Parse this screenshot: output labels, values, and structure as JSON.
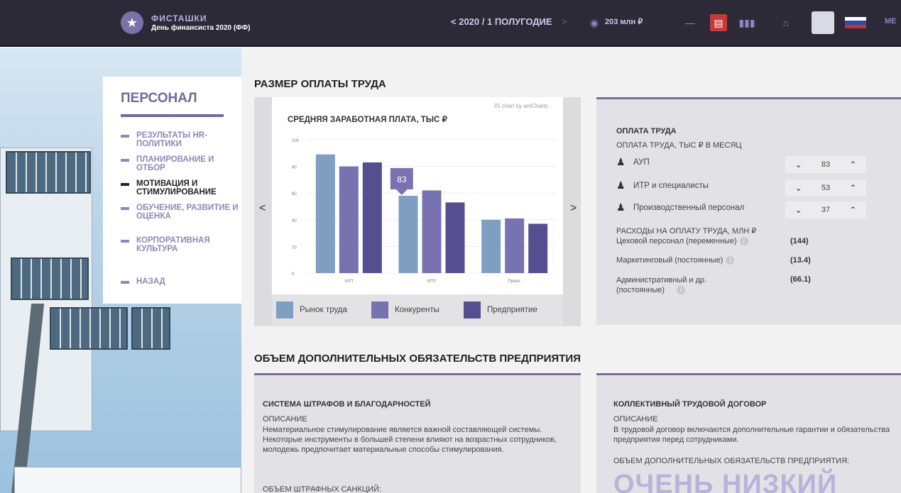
{
  "topbar": {
    "brand_name": "ФИСТАШКИ",
    "brand_sub": "День финансиста 2020 (ФФ)",
    "period_prev": "<",
    "period_label": "2020 / 1 ПОЛУГОДИЕ",
    "period_next": ">",
    "budget": "203 млн ₽",
    "menu_short": "МЕ",
    "icons": [
      "star-icon",
      "coins-icon",
      "minus-icon",
      "book-icon",
      "chart-icon",
      "briefcase-icon",
      "avatar",
      "flag-icon"
    ],
    "book_color": "#c73a3a"
  },
  "menu": {
    "title": "ПЕРСОНАЛ",
    "items": [
      {
        "label": "РЕЗУЛЬТАТЫ HR-ПОЛИТИКИ"
      },
      {
        "label": "ПЛАНИРОВАНИЕ И ОТБОР"
      },
      {
        "label": "МОТИВАЦИЯ И СТИМУЛИРОВАНИЕ",
        "active": true
      },
      {
        "label": "ОБУЧЕНИЕ, РАЗВИТИЕ И ОЦЕНКА"
      },
      {
        "label": "КОРПОРАТИВНАЯ КУЛЬТУРА"
      }
    ],
    "back": "НАЗАД"
  },
  "section1": {
    "title": "РАЗМЕР ОПЛАТЫ ТРУДА"
  },
  "chart": {
    "credit": "JS chart by amCharts",
    "prev_arrow": "<",
    "next_arrow": ">",
    "tooltip": "83"
  },
  "chart_data": {
    "type": "bar",
    "title": "СРЕДНЯЯ ЗАРАБОТНАЯ ПЛАТА, ТЫС ₽",
    "categories": [
      "АУП",
      "ИТР",
      "Произ."
    ],
    "series": [
      {
        "name": "Рынок труда",
        "color": "#7e9ec2",
        "values": [
          89,
          58,
          40
        ]
      },
      {
        "name": "Конкуренты",
        "color": "#7873b0",
        "values": [
          80,
          62,
          41
        ]
      },
      {
        "name": "Предприятие",
        "color": "#54508f",
        "values": [
          83,
          53,
          37
        ]
      }
    ],
    "ylim": [
      0,
      100
    ],
    "yticks": [
      0,
      20,
      40,
      60,
      80,
      100
    ],
    "legend": "bottom"
  },
  "pay": {
    "title": "ОПЛАТА ТРУДА",
    "subtitle": "ОПЛАТА ТРУДА, ТЫС ₽ В МЕСЯЦ",
    "roles": [
      {
        "label": "АУП",
        "value": "83"
      },
      {
        "label": "ИТР и специалисты",
        "value": "53"
      },
      {
        "label": "Производственный персонал",
        "value": "37"
      }
    ],
    "expenses_title": "РАСХОДЫ НА ОПЛАТУ ТРУДА, МЛН ₽",
    "expenses": [
      {
        "label": "Цеховой персонал (переменные)",
        "value": "(144)"
      },
      {
        "label": "Маркетинговый (постоянные)",
        "value": "(13.4)"
      },
      {
        "label": "Административный и др. (постоянные)",
        "value": "(66.1)"
      }
    ]
  },
  "section2": {
    "title": "ОБЪЕМ ДОПОЛНИТЕЛЬНЫХ ОБЯЗАТЕЛЬСТВ ПРЕДПРИЯТИЯ"
  },
  "fines": {
    "title": "СИСТЕМА ШТРАФОВ И БЛАГОДАРНОСТЕЙ",
    "desc_label": "ОПИСАНИЕ",
    "desc": "Нематериальное стимулирование является важной составляющей системы. Некоторые инструменты в большей степени влияют на возрастных сотрудников, молодежь предпочитает материальные способы стимулирования.",
    "amount_label": "ОБЪЕМ ШТРАФНЫХ САНКЦИЙ:"
  },
  "agreement": {
    "title": "КОЛЛЕКТИВНЫЙ ТРУДОВОЙ ДОГОВОР",
    "desc_label": "ОПИСАНИЕ",
    "desc": "В трудовой договор включаются дополнительные гарантии и обязательства предприятия перед сотрудниками.",
    "amount_label": "ОБЪЕМ ДОПОЛНИТЕЛЬНЫХ ОБЯЗАТЕЛЬСТВ ПРЕДПРИЯТИЯ:",
    "level": "ОЧЕНЬ НИЗКИЙ"
  }
}
